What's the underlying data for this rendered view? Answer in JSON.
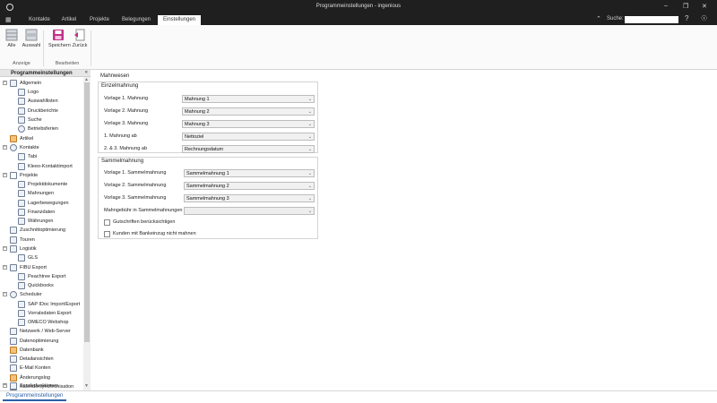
{
  "window": {
    "title": "Programmeinstellungen - ingenious",
    "minimize": "–",
    "maximize": "❐",
    "close": "✕"
  },
  "tabs": [
    {
      "label": "Kontakte"
    },
    {
      "label": "Artikel"
    },
    {
      "label": "Projekte"
    },
    {
      "label": "Belegungen"
    },
    {
      "label": "Einstellungen"
    }
  ],
  "search": {
    "label": "Suche:",
    "value": ""
  },
  "ribbon": {
    "buttons": [
      {
        "label": "Alle"
      },
      {
        "label": "Auswahl"
      },
      {
        "label": "Speichern"
      },
      {
        "label": "Zurück"
      }
    ],
    "groups": [
      {
        "label": "Anzeige"
      },
      {
        "label": "Bearbeiten"
      }
    ]
  },
  "sidebar": {
    "title": "Programmeinstellungen",
    "collapse": "«",
    "items": [
      {
        "label": "Allgemein",
        "expander": "−"
      },
      {
        "label": "Logo"
      },
      {
        "label": "Auswahllisten"
      },
      {
        "label": "Druckberichte"
      },
      {
        "label": "Suche"
      },
      {
        "label": "Betriebsferien"
      },
      {
        "label": "Artikel"
      },
      {
        "label": "Kontakte",
        "expander": "−"
      },
      {
        "label": "Tabi"
      },
      {
        "label": "Kleeo-Kontaktimport"
      },
      {
        "label": "Projekte",
        "expander": "−"
      },
      {
        "label": "Projektdokumente"
      },
      {
        "label": "Mahnungen"
      },
      {
        "label": "Lagerbewegungen"
      },
      {
        "label": "Finanzdaten"
      },
      {
        "label": "Währungen"
      },
      {
        "label": "Zuschnittoptimierung"
      },
      {
        "label": "Touren"
      },
      {
        "label": "Logistik",
        "expander": "−"
      },
      {
        "label": "GLS"
      },
      {
        "label": "FIBU Export",
        "expander": "−"
      },
      {
        "label": "Peachtree Export"
      },
      {
        "label": "Quickbooks"
      },
      {
        "label": "Scheduler",
        "expander": "−"
      },
      {
        "label": "SAP IDoc Import/Export"
      },
      {
        "label": "Vorratsdaten Export"
      },
      {
        "label": "OMECO Webshop"
      },
      {
        "label": "Netzwerk / Web-Server"
      },
      {
        "label": "Datenoptimierung"
      },
      {
        "label": "Datenbank"
      },
      {
        "label": "Detailansichten"
      },
      {
        "label": "E-Mail Konten"
      },
      {
        "label": "Änderungslog"
      },
      {
        "label": "Kalendersynchronisation"
      },
      {
        "label": "Sonderfunktionen",
        "expander": "+"
      }
    ]
  },
  "bottom_tab": "Programmeinstellungen",
  "main": {
    "title": "Mahnwesen",
    "einzel": {
      "title": "Einzelmahnung",
      "rows": [
        {
          "label": "Vorlage 1. Mahnung",
          "value": "Mahnung 1"
        },
        {
          "label": "Vorlage 2. Mahnung",
          "value": "Mahnung 2"
        },
        {
          "label": "Vorlage 3. Mahnung",
          "value": "Mahnung 3"
        },
        {
          "label": "1. Mahnung ab",
          "value": "Nettoziel"
        },
        {
          "label": "2. & 3. Mahnung ab",
          "value": "Rechnungsdatum"
        }
      ]
    },
    "sammel": {
      "title": "Sammelmahnung",
      "rows": [
        {
          "label": "Vorlage 1. Sammelmahnung",
          "value": "Sammelmahnung 1"
        },
        {
          "label": "Vorlage 2. Sammelmahnung",
          "value": "Sammelmahnung 2"
        },
        {
          "label": "Vorlage 3. Sammelmahnung",
          "value": "Sammelmahnung 3"
        },
        {
          "label": "Mahngebühr in Sammelmahnungen",
          "value": ""
        }
      ],
      "checkboxes": [
        {
          "label": "Gutschriften berücksichtigen",
          "checked": false
        },
        {
          "label": "Kunden mit Bankeinzug nicht mahnen",
          "checked": false
        }
      ]
    }
  }
}
